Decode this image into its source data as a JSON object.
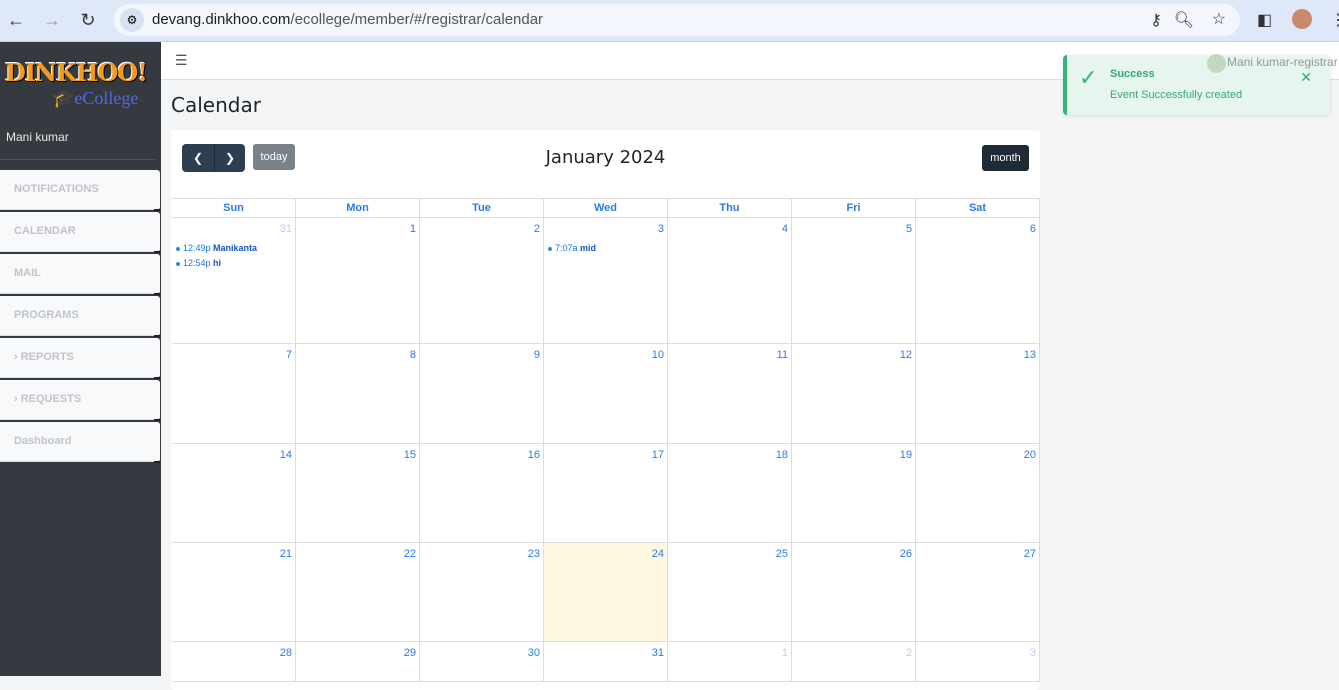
{
  "browser": {
    "url_host": "devang.dinkhoo.com",
    "url_path": "/ecollege/member/#/registrar/calendar"
  },
  "sidebar": {
    "logo_main": "DINKHOO!",
    "logo_sub": "eCollege",
    "user": "Mani kumar",
    "items": [
      {
        "label": "NOTIFICATIONS"
      },
      {
        "label": "CALENDAR"
      },
      {
        "label": "MAIL"
      },
      {
        "label": "PROGRAMS"
      },
      {
        "label": "› REPORTS"
      },
      {
        "label": "› REQUESTS"
      },
      {
        "label": "Dashboard"
      }
    ]
  },
  "header": {
    "user": "Mani kumar-registrar"
  },
  "page": {
    "title": "Calendar"
  },
  "calendar": {
    "title": "January 2024",
    "today_label": "today",
    "month_label": "month",
    "days": [
      "Sun",
      "Mon",
      "Tue",
      "Wed",
      "Thu",
      "Fri",
      "Sat"
    ],
    "weeks": [
      [
        {
          "d": "31",
          "other": true,
          "events": [
            {
              "time": "12:49p",
              "title": "Manikanta"
            },
            {
              "time": "12:54p",
              "title": "hi"
            }
          ]
        },
        {
          "d": "1"
        },
        {
          "d": "2"
        },
        {
          "d": "3",
          "events": [
            {
              "time": "7:07a",
              "title": "mid"
            }
          ]
        },
        {
          "d": "4"
        },
        {
          "d": "5"
        },
        {
          "d": "6"
        }
      ],
      [
        {
          "d": "7"
        },
        {
          "d": "8"
        },
        {
          "d": "9"
        },
        {
          "d": "10"
        },
        {
          "d": "11"
        },
        {
          "d": "12"
        },
        {
          "d": "13"
        }
      ],
      [
        {
          "d": "14"
        },
        {
          "d": "15"
        },
        {
          "d": "16"
        },
        {
          "d": "17"
        },
        {
          "d": "18"
        },
        {
          "d": "19"
        },
        {
          "d": "20"
        }
      ],
      [
        {
          "d": "21"
        },
        {
          "d": "22"
        },
        {
          "d": "23"
        },
        {
          "d": "24",
          "today": true
        },
        {
          "d": "25"
        },
        {
          "d": "26"
        },
        {
          "d": "27"
        }
      ],
      [
        {
          "d": "28"
        },
        {
          "d": "29"
        },
        {
          "d": "30"
        },
        {
          "d": "31"
        },
        {
          "d": "1",
          "other": true
        },
        {
          "d": "2",
          "other": true
        },
        {
          "d": "3",
          "other": true
        }
      ]
    ]
  },
  "toast": {
    "title": "Success",
    "message": "Event Successfully created"
  }
}
